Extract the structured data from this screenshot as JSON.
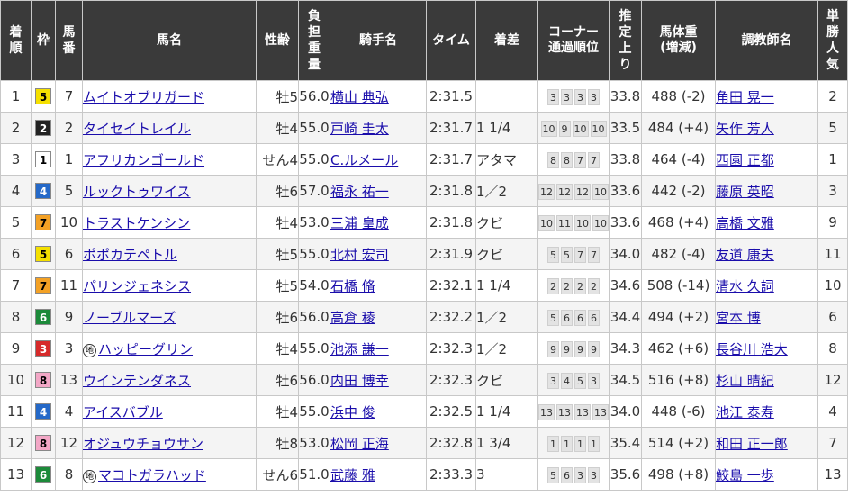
{
  "colors": {
    "header_bg": "#3a3a3a",
    "link": "#1a0dab",
    "waku": {
      "1": {
        "bg": "#ffffff",
        "fg": "#000000"
      },
      "2": {
        "bg": "#222222",
        "fg": "#ffffff"
      },
      "3": {
        "bg": "#d62a2a",
        "fg": "#ffffff"
      },
      "4": {
        "bg": "#2569c8",
        "fg": "#ffffff"
      },
      "5": {
        "bg": "#f5e000",
        "fg": "#000000"
      },
      "6": {
        "bg": "#1c8a3a",
        "fg": "#ffffff"
      },
      "7": {
        "bg": "#f3a125",
        "fg": "#000000"
      },
      "8": {
        "bg": "#f3a7c6",
        "fg": "#000000"
      }
    }
  },
  "headers": {
    "rank": "着順",
    "waku": "枠",
    "umaban": "馬番",
    "horse": "馬名",
    "sexage": "性齢",
    "weight": "負担重量",
    "jockey": "騎手名",
    "time": "タイム",
    "margin": "着差",
    "corner_line1": "コーナー",
    "corner_line2": "通過順位",
    "last3f": "推定上り",
    "body_line1": "馬体重",
    "body_line2": "(増減)",
    "trainer": "調教師名",
    "pop": "単勝人気"
  },
  "rows": [
    {
      "rank": "1",
      "waku": "5",
      "umaban": "7",
      "mark": "",
      "horse": "ムイトオブリガード",
      "sexage": "牡5",
      "weight": "56.0",
      "jockey": "横山 典弘",
      "time": "2:31.5",
      "margin": "",
      "corners": [
        "3",
        "3",
        "3",
        "3"
      ],
      "last3f": "33.8",
      "body": "488 (-2)",
      "trainer": "角田 晃一",
      "pop": "2"
    },
    {
      "rank": "2",
      "waku": "2",
      "umaban": "2",
      "mark": "",
      "horse": "タイセイトレイル",
      "sexage": "牡4",
      "weight": "55.0",
      "jockey": "戸崎 圭太",
      "time": "2:31.7",
      "margin": "1 1/4",
      "corners": [
        "10",
        "9",
        "10",
        "10"
      ],
      "last3f": "33.5",
      "body": "484 (+4)",
      "trainer": "矢作 芳人",
      "pop": "5"
    },
    {
      "rank": "3",
      "waku": "1",
      "umaban": "1",
      "mark": "",
      "horse": "アフリカンゴールド",
      "sexage": "せん4",
      "weight": "55.0",
      "jockey": "C.ルメール",
      "time": "2:31.7",
      "margin": "アタマ",
      "corners": [
        "8",
        "8",
        "7",
        "7"
      ],
      "last3f": "33.8",
      "body": "464 (-4)",
      "trainer": "西園 正都",
      "pop": "1"
    },
    {
      "rank": "4",
      "waku": "4",
      "umaban": "5",
      "mark": "",
      "horse": "ルックトゥワイス",
      "sexage": "牡6",
      "weight": "57.0",
      "jockey": "福永 祐一",
      "time": "2:31.8",
      "margin": "1／2",
      "corners": [
        "12",
        "12",
        "12",
        "10"
      ],
      "last3f": "33.6",
      "body": "442 (-2)",
      "trainer": "藤原 英昭",
      "pop": "3"
    },
    {
      "rank": "5",
      "waku": "7",
      "umaban": "10",
      "mark": "",
      "horse": "トラストケンシン",
      "sexage": "牡4",
      "weight": "53.0",
      "jockey": "三浦 皇成",
      "time": "2:31.8",
      "margin": "クビ",
      "corners": [
        "10",
        "11",
        "10",
        "10"
      ],
      "last3f": "33.6",
      "body": "468 (+4)",
      "trainer": "高橋 文雅",
      "pop": "9"
    },
    {
      "rank": "6",
      "waku": "5",
      "umaban": "6",
      "mark": "",
      "horse": "ポポカテペトル",
      "sexage": "牡5",
      "weight": "55.0",
      "jockey": "北村 宏司",
      "time": "2:31.9",
      "margin": "クビ",
      "corners": [
        "5",
        "5",
        "7",
        "7"
      ],
      "last3f": "34.0",
      "body": "482 (-4)",
      "trainer": "友道 康夫",
      "pop": "11"
    },
    {
      "rank": "7",
      "waku": "7",
      "umaban": "11",
      "mark": "",
      "horse": "パリンジェネシス",
      "sexage": "牡5",
      "weight": "54.0",
      "jockey": "石橋 脩",
      "time": "2:32.1",
      "margin": "1 1/4",
      "corners": [
        "2",
        "2",
        "2",
        "2"
      ],
      "last3f": "34.6",
      "body": "508 (-14)",
      "trainer": "清水 久詞",
      "pop": "10"
    },
    {
      "rank": "8",
      "waku": "6",
      "umaban": "9",
      "mark": "",
      "horse": "ノーブルマーズ",
      "sexage": "牡6",
      "weight": "56.0",
      "jockey": "高倉 稜",
      "time": "2:32.2",
      "margin": "1／2",
      "corners": [
        "5",
        "6",
        "6",
        "6"
      ],
      "last3f": "34.4",
      "body": "494 (+2)",
      "trainer": "宮本 博",
      "pop": "6"
    },
    {
      "rank": "9",
      "waku": "3",
      "umaban": "3",
      "mark": "地",
      "horse": "ハッピーグリン",
      "sexage": "牡4",
      "weight": "55.0",
      "jockey": "池添 謙一",
      "time": "2:32.3",
      "margin": "1／2",
      "corners": [
        "9",
        "9",
        "9",
        "9"
      ],
      "last3f": "34.3",
      "body": "462 (+6)",
      "trainer": "長谷川 浩大",
      "pop": "8"
    },
    {
      "rank": "10",
      "waku": "8",
      "umaban": "13",
      "mark": "",
      "horse": "ウインテンダネス",
      "sexage": "牡6",
      "weight": "56.0",
      "jockey": "内田 博幸",
      "time": "2:32.3",
      "margin": "クビ",
      "corners": [
        "3",
        "4",
        "5",
        "3"
      ],
      "last3f": "34.5",
      "body": "516 (+8)",
      "trainer": "杉山 晴紀",
      "pop": "12"
    },
    {
      "rank": "11",
      "waku": "4",
      "umaban": "4",
      "mark": "",
      "horse": "アイスバブル",
      "sexage": "牡4",
      "weight": "55.0",
      "jockey": "浜中 俊",
      "time": "2:32.5",
      "margin": "1 1/4",
      "corners": [
        "13",
        "13",
        "13",
        "13"
      ],
      "last3f": "34.0",
      "body": "448 (-6)",
      "trainer": "池江 泰寿",
      "pop": "4"
    },
    {
      "rank": "12",
      "waku": "8",
      "umaban": "12",
      "mark": "",
      "horse": "オジュウチョウサン",
      "sexage": "牡8",
      "weight": "53.0",
      "jockey": "松岡 正海",
      "time": "2:32.8",
      "margin": "1 3/4",
      "corners": [
        "1",
        "1",
        "1",
        "1"
      ],
      "last3f": "35.4",
      "body": "514 (+2)",
      "trainer": "和田 正一郎",
      "pop": "7"
    },
    {
      "rank": "13",
      "waku": "6",
      "umaban": "8",
      "mark": "地",
      "horse": "マコトガラハッド",
      "sexage": "せん6",
      "weight": "51.0",
      "jockey": "武藤 雅",
      "time": "2:33.3",
      "margin": "3",
      "corners": [
        "5",
        "6",
        "3",
        "3"
      ],
      "last3f": "35.6",
      "body": "498 (+8)",
      "trainer": "鮫島 一歩",
      "pop": "13"
    }
  ]
}
